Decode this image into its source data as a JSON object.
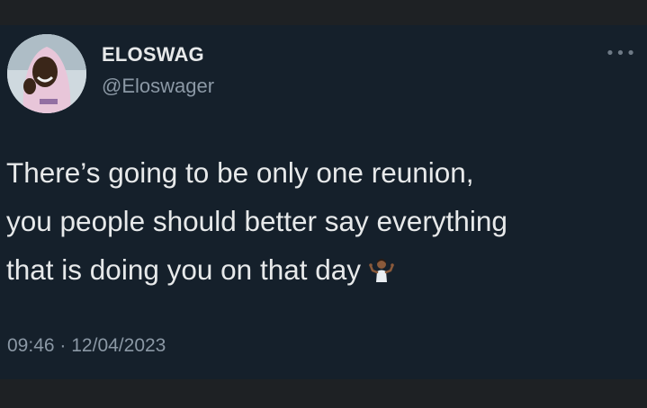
{
  "author": {
    "name": "ELOSWAG",
    "handle": "@Eloswager"
  },
  "more_menu_glyph": "•••",
  "tweet": {
    "lines": [
      "There’s going to be only one reunion,",
      "you people should better say everything",
      "that is doing you on that day"
    ],
    "emoji": "person-shrugging-icon",
    "time": "09:46",
    "separator": "·",
    "date": "12/04/2023"
  },
  "colors": {
    "background": "#15202b",
    "text_primary": "#e7e9ea",
    "text_secondary": "#8b98a5"
  }
}
